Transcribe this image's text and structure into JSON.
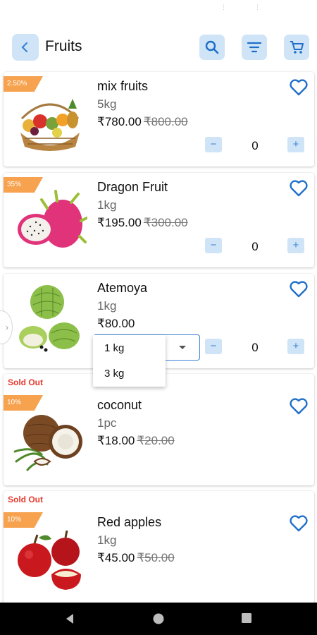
{
  "header": {
    "title": "Fruits",
    "back_icon": "chevron-left-icon",
    "search_icon": "search-icon",
    "filter_icon": "filter-icon",
    "cart_icon": "cart-icon"
  },
  "colors": {
    "accent": "#3c82d6",
    "button_bg": "#cfe5f7",
    "discount_badge": "#f6a24e",
    "sold_out": "#e53a2e"
  },
  "products": [
    {
      "discount": "2.50%",
      "name": "mix fruits",
      "unit": "5kg",
      "price": "₹780.00",
      "mrp": "₹800.00",
      "quantity": "0",
      "image_icon": "fruit-basket-icon"
    },
    {
      "discount": "35%",
      "name": "Dragon Fruit",
      "unit": "1kg",
      "price": "₹195.00",
      "mrp": "₹300.00",
      "quantity": "0",
      "image_icon": "dragon-fruit-icon"
    },
    {
      "name": "Atemoya",
      "unit": "1kg",
      "price": "₹80.00",
      "quantity": "0",
      "image_icon": "atemoya-icon"
    },
    {
      "sold_out": "Sold Out",
      "discount": "10%",
      "name": "coconut",
      "unit": "1pc",
      "price": "₹18.00",
      "mrp": "₹20.00",
      "image_icon": "coconut-icon"
    },
    {
      "sold_out": "Sold Out",
      "discount": "10%",
      "name": "Red apples",
      "unit": "1kg",
      "price": "₹45.00",
      "mrp": "₹50.00",
      "image_icon": "apple-icon"
    }
  ],
  "unit_dropdown": {
    "options": [
      "1 kg",
      "3 kg"
    ]
  },
  "qty_controls": {
    "minus": "−",
    "plus": "+"
  },
  "system_nav": {
    "back": "nav-back-icon",
    "home": "nav-home-icon",
    "recents": "nav-recents-icon"
  }
}
